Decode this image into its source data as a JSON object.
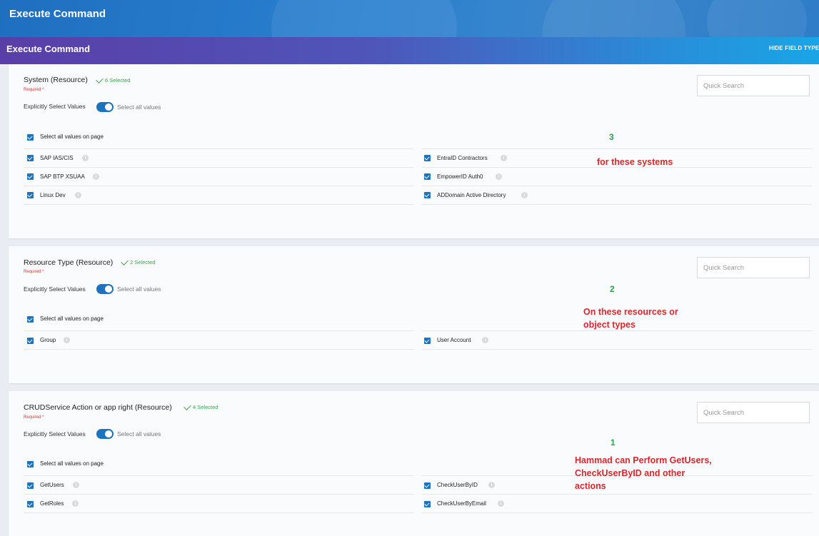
{
  "app": {
    "window_title": "Execute Command",
    "header_title": "Execute Command",
    "hide_field_types": "HIDE FIELD TYPES"
  },
  "colors": {
    "accent": "#1e73be",
    "selected_green": "#3aa14a",
    "required_red": "#dd3333",
    "annotation_red": "#d8262a",
    "annotation_green": "#2aa04a"
  },
  "common": {
    "required": "Required *",
    "explicit_label": "Explicitly Select Values",
    "select_all_values": "Select all values",
    "select_all_on_page": "Select all values on page",
    "search_placeholder": "Quick Search"
  },
  "sections": [
    {
      "title": "System (Resource)",
      "selected": "6 Selected",
      "options": [
        {
          "label": "SAP IAS/CIS",
          "checked": true
        },
        {
          "label": "EntraID Contractors",
          "checked": true
        },
        {
          "label": "SAP BTP XSUAA",
          "checked": true
        },
        {
          "label": "EmpowerID Auth0",
          "checked": true
        },
        {
          "label": "Linux Dev",
          "checked": true
        },
        {
          "label": "ADDomain Active Directory",
          "checked": true
        }
      ],
      "annotation": {
        "number": "3",
        "text": "for these systems"
      }
    },
    {
      "title": "Resource Type (Resource)",
      "selected": "2 Selected",
      "options": [
        {
          "label": "Group",
          "checked": true
        },
        {
          "label": "User Account",
          "checked": true
        }
      ],
      "annotation": {
        "number": "2",
        "text_line1": "On these resources or",
        "text_line2": "object types"
      }
    },
    {
      "title": "CRUDService Action or app right (Resource)",
      "selected": "4 Selected",
      "options": [
        {
          "label": "GetUsers",
          "checked": true
        },
        {
          "label": "CheckUserByID",
          "checked": true
        },
        {
          "label": "GetRoles",
          "checked": true
        },
        {
          "label": "CheckUserByEmail",
          "checked": true
        }
      ],
      "annotation": {
        "number": "1",
        "text_line1": "Hammad can Perform GetUsers,",
        "text_line2": "CheckUserByID and other",
        "text_line3": "actions"
      }
    }
  ]
}
